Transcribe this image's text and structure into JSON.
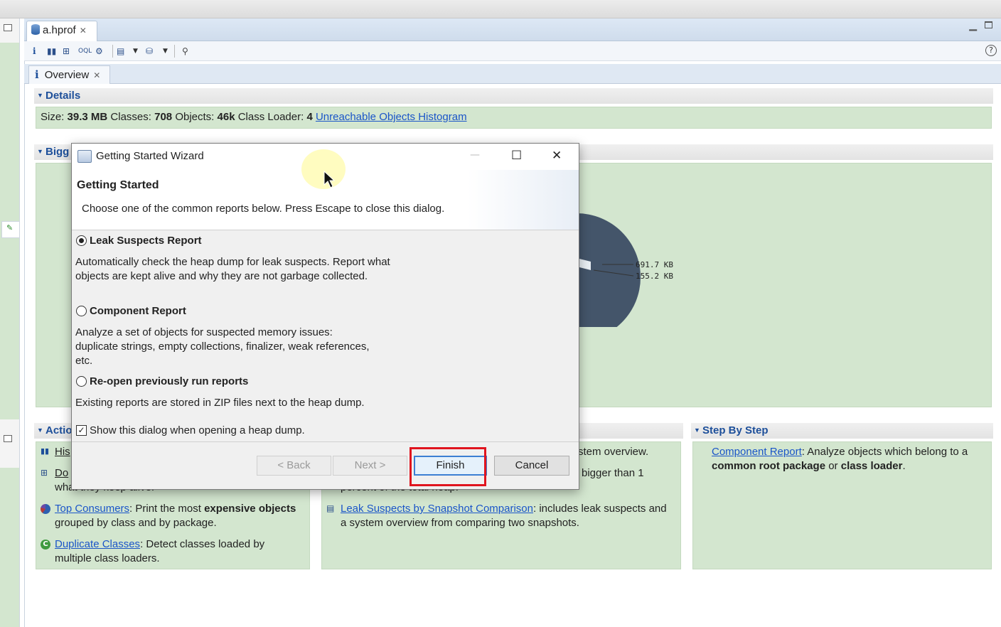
{
  "editor": {
    "file_tab": "a.hprof",
    "overview_tab": "Overview",
    "help_icon": "?"
  },
  "details": {
    "heading": "Details",
    "size_label": "Size:",
    "size_value": "39.3 MB",
    "classes_label": "Classes:",
    "classes_value": "708",
    "objects_label": "Objects:",
    "objects_value": "46k",
    "loader_label": "Class Loader:",
    "loader_value": "4",
    "histogram_link": "Unreachable Objects Histogram"
  },
  "biggest": {
    "heading_partial": "Bigg",
    "label_1": "691.7 KB",
    "label_2": "155.2 KB"
  },
  "actions": {
    "heading_partial": "Actio",
    "hist_partial": "His",
    "dom_partial": "Do",
    "dom_desc_partial": "what they keep alive.",
    "top_consumers_link": "Top Consumers",
    "top_consumers_text_1": ": Print the most ",
    "top_consumers_bold_1": "expensive",
    "top_consumers_bold_2": "objects",
    "top_consumers_text_2": " grouped by class and by package.",
    "duplicate_link": "Duplicate Classes",
    "duplicate_text": ": Detect classes loaded by multiple class loaders."
  },
  "reports": {
    "overview_partial": "stem overview.",
    "bigger_partial": "bigger than 1",
    "percent_partial": "percent of the total heap.",
    "comparison_link": "Leak Suspects by Snapshot Comparison",
    "comparison_text": ": includes leak suspects and a system overview from comparing two snapshots."
  },
  "step_by_step": {
    "heading": "Step By Step",
    "component_link": "Component Report",
    "component_text_1": ": Analyze objects which belong to a ",
    "component_bold_1": "common root package",
    "component_text_2": " or ",
    "component_bold_2": "class loader",
    "component_text_3": "."
  },
  "dialog": {
    "title": "Getting Started Wizard",
    "heading": "Getting Started",
    "subtitle": "Choose one of the common reports below. Press Escape to close this dialog.",
    "options": [
      {
        "label": "Leak Suspects Report",
        "selected": true,
        "desc": "Automatically check the heap dump for leak suspects. Report what objects are kept alive and why they are not garbage collected."
      },
      {
        "label": "Component Report",
        "selected": false,
        "desc": "Analyze a set of objects for suspected memory issues: duplicate strings, empty collections, finalizer, weak references, etc."
      },
      {
        "label": "Re-open previously run reports",
        "selected": false,
        "desc": "Existing reports are stored in ZIP files next to the heap dump."
      }
    ],
    "checkbox_label": "Show this dialog when opening a heap dump.",
    "checkbox_checked": true,
    "buttons": {
      "back": "< Back",
      "next": "Next >",
      "finish": "Finish",
      "cancel": "Cancel"
    },
    "window_controls": {
      "minimize": "—",
      "maximize": "☐",
      "close": "✕"
    }
  },
  "colors": {
    "panel_green": "#d3e6cf",
    "link_blue": "#1a55c8",
    "heading_blue": "#1d4f9a",
    "highlight_red": "#e0141e"
  }
}
